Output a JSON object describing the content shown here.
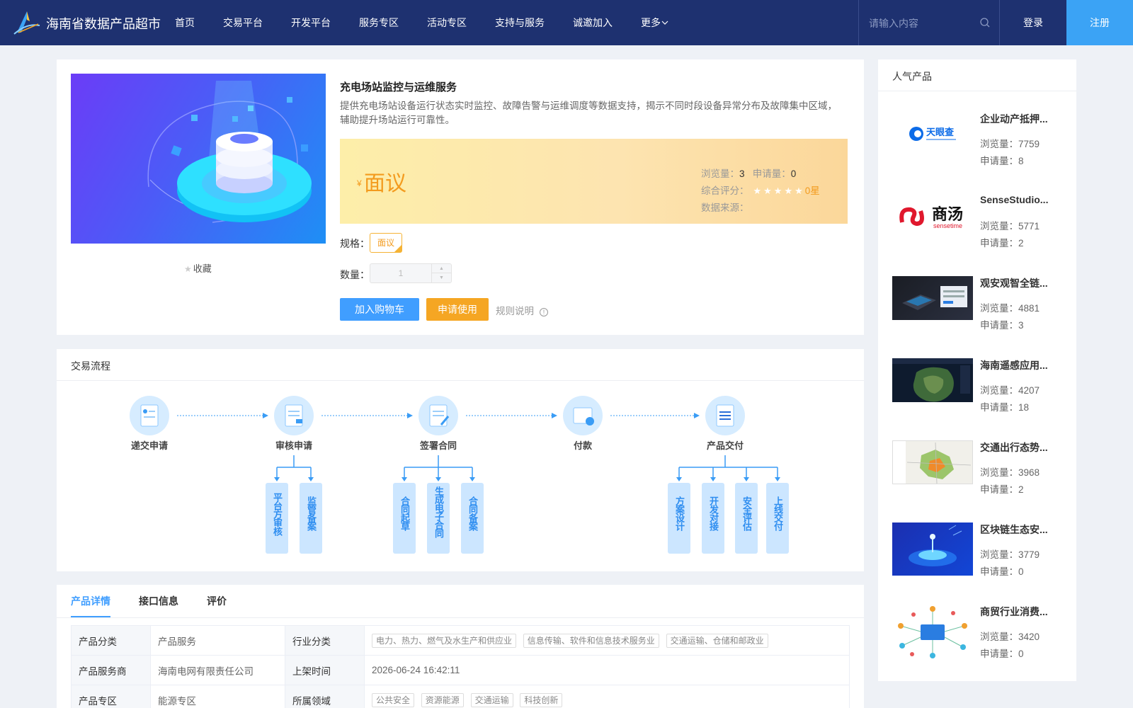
{
  "header": {
    "brand": "海南省数据产品超市",
    "nav": [
      "首页",
      "交易平台",
      "开发平台",
      "服务专区",
      "活动专区",
      "支持与服务",
      "诚邀加入",
      "更多"
    ],
    "search_placeholder": "请输入内容",
    "login": "登录",
    "register": "注册",
    "colors": {
      "bar": "#1e3170",
      "register": "#3ba3f5"
    }
  },
  "product": {
    "favorite": "收藏",
    "title": "充电场站监控与运维服务",
    "description": "提供充电场站设备运行状态实时监控、故障告警与运维调度等数据支持，揭示不同时段设备异常分布及故障集中区域，辅助提升场站运行可靠性。",
    "currency": "¥",
    "price": "面议",
    "views_label": "浏览量：",
    "views": "3",
    "applies_label": "申请量：",
    "applies": "0",
    "rating_label": "综合评分：",
    "rating": "0星",
    "rating_stars": 0,
    "source_label": "数据来源：",
    "spec_label": "规格：",
    "spec_value": "面议",
    "qty_label": "数量：",
    "qty_value": "1",
    "add_cart": "加入购物车",
    "apply": "申请使用",
    "rules": "规则说明"
  },
  "flow": {
    "title": "交易流程",
    "steps": [
      "递交申请",
      "审核申请",
      "签署合同",
      "付款",
      "产品交付"
    ],
    "sub_review": [
      "平台方审核",
      "监管备案"
    ],
    "sub_contract": [
      "合同起草",
      "生成电子合同",
      "合同备案"
    ],
    "sub_delivery": [
      "方案设计",
      "开发对接",
      "安全评估",
      "上线交付"
    ]
  },
  "detail": {
    "tabs": [
      "产品详情",
      "接口信息",
      "评价"
    ],
    "rows": [
      {
        "k1": "产品分类",
        "v1": "产品服务",
        "k2": "行业分类",
        "tags": [
          "电力、热力、燃气及水生产和供应业",
          "信息传输、软件和信息技术服务业",
          "交通运输、仓储和邮政业"
        ]
      },
      {
        "k1": "产品服务商",
        "v1": "海南电网有限责任公司",
        "k2": "上架时间",
        "v2": "2026-06-24 16:42:11"
      },
      {
        "k1": "产品专区",
        "v1": "能源专区",
        "k2": "所属领域",
        "tags": [
          "公共安全",
          "资源能源",
          "交通运输",
          "科技创新"
        ]
      }
    ]
  },
  "sidebar": {
    "title": "人气产品",
    "views_label": "浏览量：",
    "applies_label": "申请量：",
    "logo_text_tianyancha": "天眼查",
    "logo_text_sensetime": "商汤",
    "logo_sub_sensetime": "sensetime",
    "items": [
      {
        "name": "企业动产抵押...",
        "views": "7759",
        "applies": "8"
      },
      {
        "name": "SenseStudio...",
        "views": "5771",
        "applies": "2"
      },
      {
        "name": "观安观智全链...",
        "views": "4881",
        "applies": "3"
      },
      {
        "name": "海南遥感应用...",
        "views": "4207",
        "applies": "18"
      },
      {
        "name": "交通出行态势...",
        "views": "3968",
        "applies": "2"
      },
      {
        "name": "区块链生态安...",
        "views": "3779",
        "applies": "0"
      },
      {
        "name": "商贸行业消费...",
        "views": "3420",
        "applies": "0"
      }
    ]
  }
}
